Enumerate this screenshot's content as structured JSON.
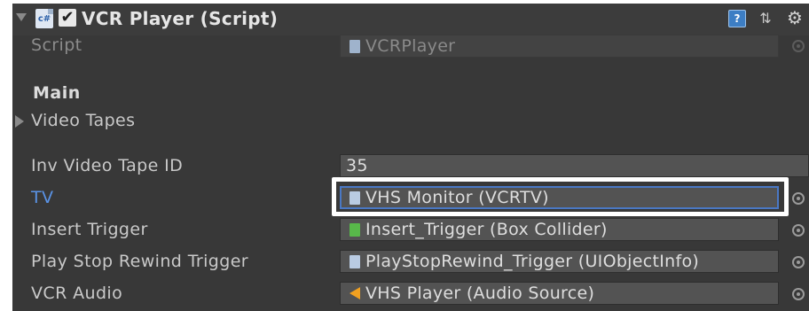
{
  "component": {
    "title": "VCR Player (Script)",
    "icon_text": "c#",
    "enabled": true,
    "help_icon_text": "?"
  },
  "script_field": {
    "label": "Script",
    "value": "VCRPlayer"
  },
  "section": {
    "title": "Main"
  },
  "video_tapes": {
    "label": "Video Tapes"
  },
  "fields": {
    "inv_video_tape_id": {
      "label": "Inv Video Tape ID",
      "value": "35"
    },
    "tv": {
      "label": "TV",
      "value": "VHS Monitor (VCRTV)"
    },
    "insert_trigger": {
      "label": "Insert Trigger",
      "value": "Insert_Trigger (Box Collider)"
    },
    "play_stop_rewind_trigger": {
      "label": "Play Stop Rewind Trigger",
      "value": "PlayStopRewind_Trigger (UIObjectInfo)"
    },
    "vcr_audio": {
      "label": "VCR Audio",
      "value": "VHS Player (Audio Source)"
    }
  },
  "colors": {
    "panel_bg": "#383838",
    "field_bg": "#535353",
    "selected_label": "#5a93e6",
    "selected_border": "#4a78c4",
    "highlight_frame": "#ffffff"
  },
  "icons": {
    "foldout": "triangle-down",
    "script": "csharp-script-icon",
    "help": "help-book-icon",
    "presets": "presets-icon",
    "settings": "gear-icon",
    "object_picker": "circle-target-icon",
    "audio_source": "speaker-icon",
    "box_collider": "green-cube-icon"
  }
}
